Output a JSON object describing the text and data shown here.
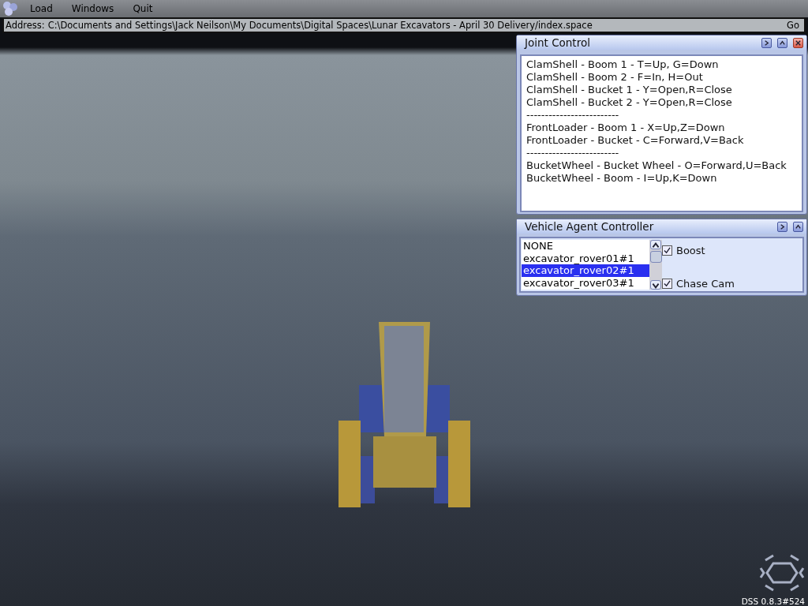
{
  "menu": [
    {
      "label": "Load"
    },
    {
      "label": "Windows"
    },
    {
      "label": "Quit"
    }
  ],
  "address_bar": {
    "label": "Address:",
    "value": "C:\\Documents and Settings\\Jack Neilson\\My Documents\\Digital Spaces\\Lunar Excavators - April 30 Delivery/index.space",
    "button": "Go"
  },
  "joint_control": {
    "title": "Joint Control",
    "lines": [
      "ClamShell - Boom 1 - T=Up, G=Down",
      "ClamShell - Boom 2 - F=In, H=Out",
      "ClamShell - Bucket 1 - Y=Open,R=Close",
      "ClamShell - Bucket 2 - Y=Open,R=Close",
      "-------------------------",
      "FrontLoader - Boom 1 - X=Up,Z=Down",
      "FrontLoader - Bucket - C=Forward,V=Back",
      "-------------------------",
      "BucketWheel - Bucket Wheel - O=Forward,U=Back",
      "BucketWheel - Boom - I=Up,K=Down"
    ]
  },
  "vehicle_agent_controller": {
    "title": "Vehicle Agent Controller",
    "agents": [
      {
        "label": "NONE",
        "selected": false
      },
      {
        "label": "excavator_rover01#1",
        "selected": false
      },
      {
        "label": "excavator_rover02#1",
        "selected": true
      },
      {
        "label": "excavator_rover03#1",
        "selected": false
      }
    ],
    "options": [
      {
        "label": "Boost",
        "checked": true
      },
      {
        "label": "Chase Cam",
        "checked": true
      }
    ]
  },
  "version": "DSS 0.8.3#524"
}
